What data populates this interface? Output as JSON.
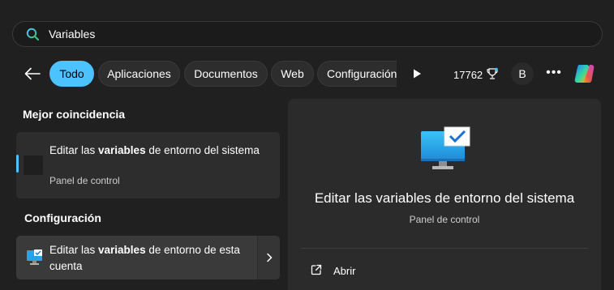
{
  "search": {
    "value": "Variables",
    "placeholder": ""
  },
  "filters": [
    {
      "label": "Todo",
      "active": true
    },
    {
      "label": "Aplicaciones",
      "active": false
    },
    {
      "label": "Documentos",
      "active": false
    },
    {
      "label": "Web",
      "active": false
    },
    {
      "label": "Configuración",
      "active": false
    }
  ],
  "toolbar": {
    "points": "17762",
    "avatar_initial": "B"
  },
  "best_match": {
    "section_label": "Mejor coincidencia",
    "title_prefix": "Editar las ",
    "title_bold": "variables",
    "title_suffix": " de entorno del sistema",
    "subtitle": "Panel de control"
  },
  "settings": {
    "section_label": "Configuración",
    "title_prefix": "Editar las ",
    "title_bold": "variables",
    "title_suffix": " de entorno de esta cuenta"
  },
  "preview": {
    "title": "Editar las variables de entorno del sistema",
    "subtitle": "Panel de control",
    "open_label": "Abrir"
  },
  "colors": {
    "accent": "#4cc2ff",
    "background": "#202020",
    "card": "#2d2d2d"
  }
}
